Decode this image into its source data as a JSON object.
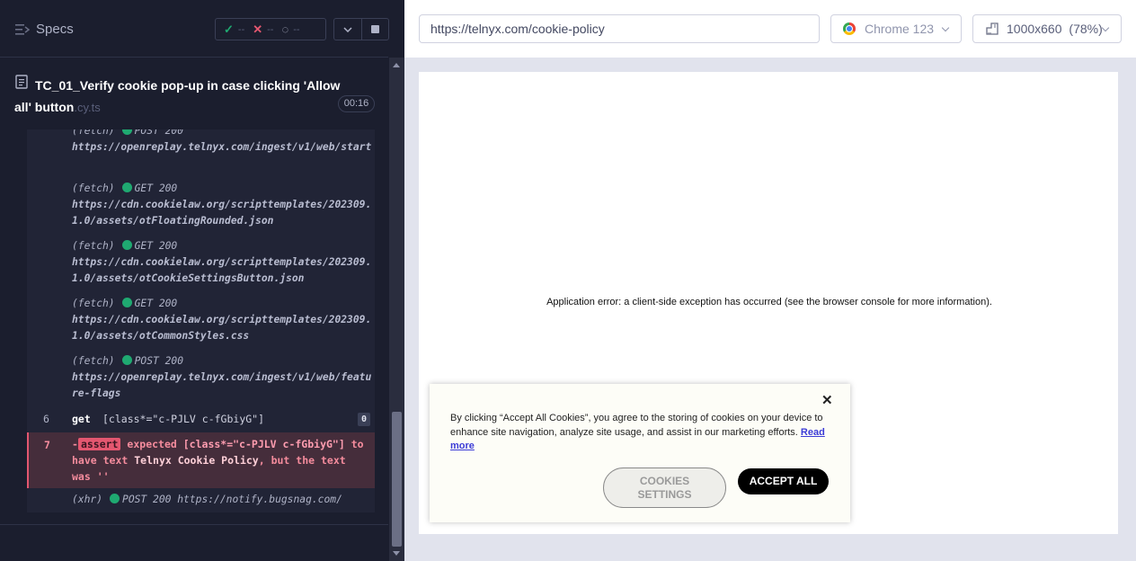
{
  "specs": {
    "title": "Specs"
  },
  "stats": {
    "passed": "--",
    "failed": "--",
    "pending": "--"
  },
  "test": {
    "title": "TC_01_Verify cookie pop-up in case clicking 'Allow all' button",
    "ext": ".cy.ts",
    "duration": "00:16"
  },
  "log": {
    "entries": [
      {
        "kind": "(fetch)",
        "method": "POST 200",
        "url": "https://openreplay.telnyx.com/ingest/v1/web/start"
      },
      {
        "kind": "(fetch)",
        "method": "GET 200",
        "url": "https://cdn.cookielaw.org/scripttemplates/202309.1.0/assets/otFloatingRounded.json"
      },
      {
        "kind": "(fetch)",
        "method": "GET 200",
        "url": "https://cdn.cookielaw.org/scripttemplates/202309.1.0/assets/otCookieSettingsButton.json"
      },
      {
        "kind": "(fetch)",
        "method": "GET 200",
        "url": "https://cdn.cookielaw.org/scripttemplates/202309.1.0/assets/otCommonStyles.css"
      },
      {
        "kind": "(fetch)",
        "method": "POST 200",
        "url": "https://openreplay.telnyx.com/ingest/v1/web/feature-flags"
      }
    ],
    "get_cmd": {
      "num": "6",
      "name": "get",
      "arg": "[class*=\"c-PJLV c-fGbiyG\"]",
      "count": "0"
    },
    "assert_cmd": {
      "num": "7",
      "prefix": "-",
      "badge": "assert",
      "w_expected": "expected",
      "selector": "[class*=\"c-PJLV c-fGbiyG\"]",
      "w_to_have_text": "to have text",
      "value": "Telnyx Cookie Policy",
      "w_but_text_was": ", but the text was",
      "actual": "''"
    },
    "xhr": {
      "kind": "(xhr)",
      "method": "POST 200",
      "url": "https://notify.bugsnag.com/"
    }
  },
  "browser": {
    "url": "https://telnyx.com/cookie-policy",
    "name": "Chrome 123",
    "viewport": "1000x660",
    "zoom": "(78%)"
  },
  "page": {
    "error": "Application error: a client-side exception has occurred (see the browser console for more information)."
  },
  "cookie": {
    "text": "By clicking “Accept All Cookies”, you agree to the storing of cookies on your device to enhance site navigation, analyze site usage, and assist in our marketing efforts.",
    "read_more": "Read more",
    "close": "✕",
    "settings_line1": "COOKIES",
    "settings_line2": "SETTINGS",
    "accept": "ACCEPT ALL"
  },
  "icons": {
    "specs": "list-icon",
    "pass": "check-icon",
    "fail": "x-icon",
    "pending": "spinner-icon",
    "test_file": "document-icon",
    "browser": "chrome-icon",
    "viewport": "ruler-icon"
  },
  "colors": {
    "pass": "#1fa971",
    "fail": "#e45770",
    "panel": "#1b1e2e"
  }
}
